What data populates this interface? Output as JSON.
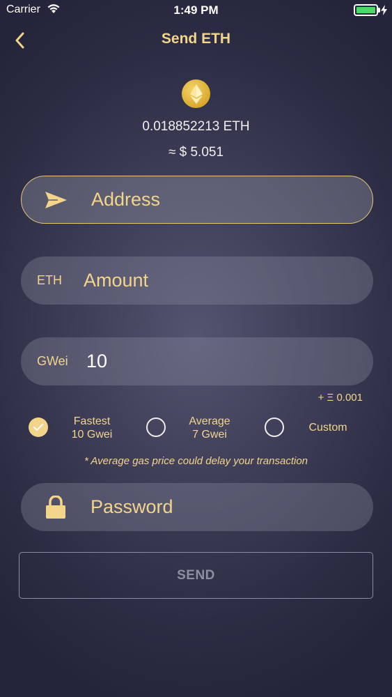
{
  "status_bar": {
    "carrier": "Carrier",
    "time": "1:49 PM"
  },
  "nav": {
    "title": "Send ETH",
    "back_icon": "chevron-left-icon"
  },
  "wallet": {
    "coin_icon": "ethereum-coin-icon",
    "balance": "0.018852213 ETH",
    "fiat_value": "≈ $ 5.051"
  },
  "form": {
    "address": {
      "placeholder": "Address",
      "icon": "paper-plane-icon"
    },
    "amount": {
      "prefix": "ETH",
      "placeholder": "Amount"
    },
    "gas": {
      "prefix": "GWei",
      "value": "10",
      "fee": "+ Ξ 0.001"
    },
    "gas_options": [
      {
        "line1": "Fastest",
        "line2": "10 Gwei",
        "selected": true
      },
      {
        "line1": "Average",
        "line2": "7 Gwei",
        "selected": false
      },
      {
        "line1": "Custom",
        "line2": "",
        "selected": false
      }
    ],
    "gas_hint": "* Average gas price could delay your transaction",
    "password": {
      "placeholder": "Password",
      "icon": "lock-icon"
    },
    "send_label": "SEND"
  },
  "colors": {
    "accent": "#f2d58a",
    "background": "#34344c",
    "field": "#5a5a70",
    "battery": "#4cd964"
  }
}
